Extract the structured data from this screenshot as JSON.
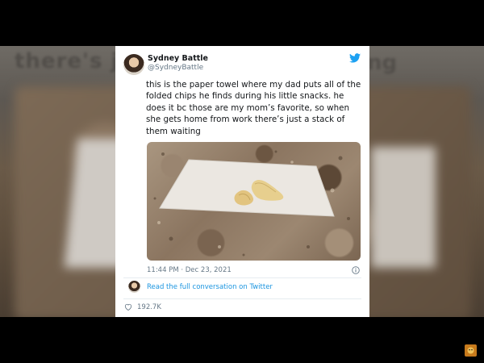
{
  "backdrop": {
    "headline_left": "there's j",
    "headline_right": "ng"
  },
  "tweet": {
    "display_name": "Sydney Battle",
    "handle": "@SydneyBattle",
    "text": "this is the paper towel where my dad puts all of the folded chips he finds during his little snacks. he does it bc those are my mom’s favorite, so when she gets home from work there’s just a stack of them waiting",
    "timestamp": "11:44 PM · Dec 23, 2021",
    "read_more": "Read the full conversation on Twitter",
    "likes": "192.7K"
  },
  "colors": {
    "twitter_blue": "#1da1f2",
    "link_blue": "#1b95e0",
    "muted_text": "#657786"
  },
  "icons": [
    "twitter-bird-icon",
    "info-icon",
    "heart-icon"
  ]
}
